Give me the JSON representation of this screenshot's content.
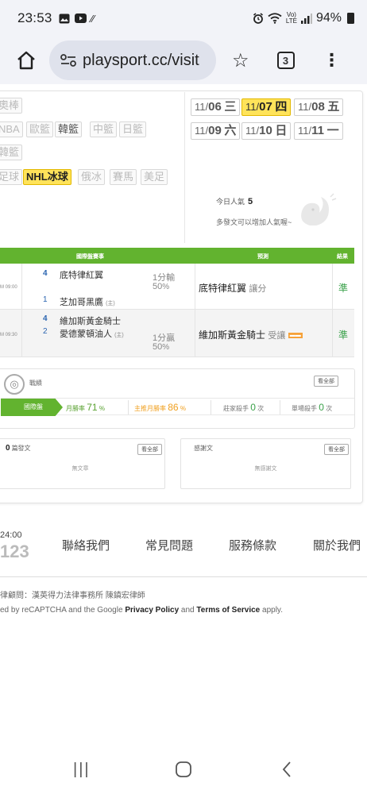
{
  "status": {
    "time": "23:53",
    "icons": [
      "gallery-icon",
      "youtube-icon",
      "signal-off-icon"
    ],
    "right_icons": [
      "alarm-icon",
      "wifi-icon",
      "volte-icon",
      "signal-bars-icon"
    ],
    "battery": "94%"
  },
  "browser": {
    "url": "playsport.cc/visit",
    "tab_count": "3"
  },
  "sports": {
    "row1": [
      "奧棒"
    ],
    "row2": [
      "NBA",
      "歐籃",
      "韓籃",
      "中籃",
      "日籃"
    ],
    "row3": [
      "韓籃"
    ],
    "row4": [
      "足球",
      "NHL冰球",
      "俄冰",
      "賽馬",
      "美足"
    ]
  },
  "dates": [
    {
      "month": "11/",
      "day": "06",
      "wd": "三"
    },
    {
      "month": "11/",
      "day": "07",
      "wd": "四"
    },
    {
      "month": "11/",
      "day": "08",
      "wd": "五"
    },
    {
      "month": "11/",
      "day": "09",
      "wd": "六"
    },
    {
      "month": "11/",
      "day": "10",
      "wd": "日"
    },
    {
      "month": "11/",
      "day": "11",
      "wd": "一"
    }
  ],
  "popularity": {
    "label": "今日人氣",
    "value": "5",
    "sub": "多發文可以增加人氣喔~"
  },
  "table": {
    "headers": {
      "game": "國際盤賽事",
      "pred": "預測",
      "result": "結果"
    },
    "rows": [
      {
        "time": "M 09:00",
        "team1_num": "4",
        "team1": "底特律紅翼",
        "team2_num": "1",
        "team2": "芝加哥黑鷹",
        "team2_tag": "(主)",
        "odds": "1分輸",
        "odds_pct": "50",
        "prediction": "底特律紅翼",
        "pred_note": "讓分",
        "result": "準"
      },
      {
        "time": "M 09:30",
        "team1_num": "4",
        "team1": "維加斯黃金騎士",
        "team2_num": "2",
        "team2": "愛德蒙頓油人",
        "team2_tag": "(主)",
        "odds": "1分贏",
        "odds_pct": "50",
        "prediction": "維加斯黃金騎士",
        "pred_note": "受讓",
        "result": "準"
      }
    ]
  },
  "record": {
    "label": "戰績",
    "see_all": "看全部",
    "tab": "國際盤",
    "month_win_label": "月勝率",
    "month_win": "71",
    "main_win_label": "主推月勝率",
    "main_win": "86",
    "banker_label": "莊家殺手",
    "banker": "0",
    "single_label": "單場殺手",
    "single": "0",
    "unit_pct": "%",
    "unit_times": "次"
  },
  "posts": {
    "count": "0",
    "title": "篇發文",
    "see_all": "看全部",
    "empty": "無文章"
  },
  "thanks": {
    "title": "感謝文",
    "see_all": "看全部",
    "empty": "無感謝文"
  },
  "footer": {
    "time": "24:00",
    "year": "123",
    "links": [
      "聯絡我們",
      "常見問題",
      "服務條款",
      "關於我們"
    ],
    "lawyer": "律顧問：漢英得力法律事務所 陳鎮宏律師",
    "recaptcha_pre": "ed by reCAPTCHA and the Google ",
    "privacy": "Privacy Policy",
    "and": " and ",
    "terms": "Terms of Service",
    "apply": " apply."
  }
}
